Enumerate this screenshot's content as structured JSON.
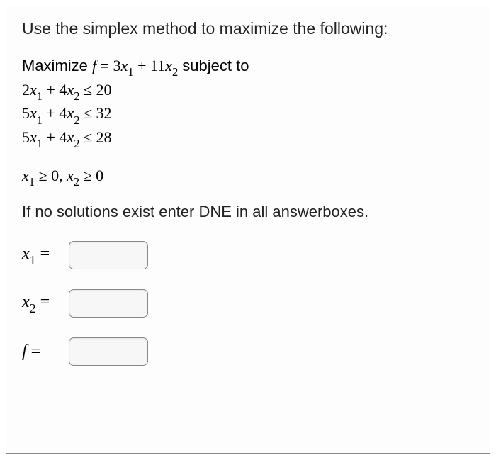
{
  "instruction": "Use the simplex method to maximize the following:",
  "problem": {
    "objective_prefix": "Maximize ",
    "objective_fn": "f",
    "objective_eq": " = 3",
    "objective_x1_coef_var": "x",
    "objective_x1_sub": "1",
    "objective_plus": " + 11",
    "objective_x2_var": "x",
    "objective_x2_sub": "2",
    "objective_suffix": " subject to",
    "constraints": [
      {
        "lhs_a": "2",
        "v1": "x",
        "s1": "1",
        "op1": " + 4",
        "v2": "x",
        "s2": "2",
        "rel": " ≤ 20"
      },
      {
        "lhs_a": "5",
        "v1": "x",
        "s1": "1",
        "op1": " + 4",
        "v2": "x",
        "s2": "2",
        "rel": " ≤ 32"
      },
      {
        "lhs_a": "5",
        "v1": "x",
        "s1": "1",
        "op1": " + 4",
        "v2": "x",
        "s2": "2",
        "rel": " ≤ 28"
      }
    ],
    "nonneg_v1": "x",
    "nonneg_s1": "1",
    "nonneg_rel1": " ≥ 0, ",
    "nonneg_v2": "x",
    "nonneg_s2": "2",
    "nonneg_rel2": " ≥ 0"
  },
  "hint": "If no solutions exist enter DNE in all answerboxes.",
  "answers": [
    {
      "label_var": "x",
      "label_sub": "1",
      "label_eq": " = ",
      "value": ""
    },
    {
      "label_var": "x",
      "label_sub": "2",
      "label_eq": " = ",
      "value": ""
    },
    {
      "label_var": "f",
      "label_sub": "",
      "label_eq": " = ",
      "value": ""
    }
  ]
}
